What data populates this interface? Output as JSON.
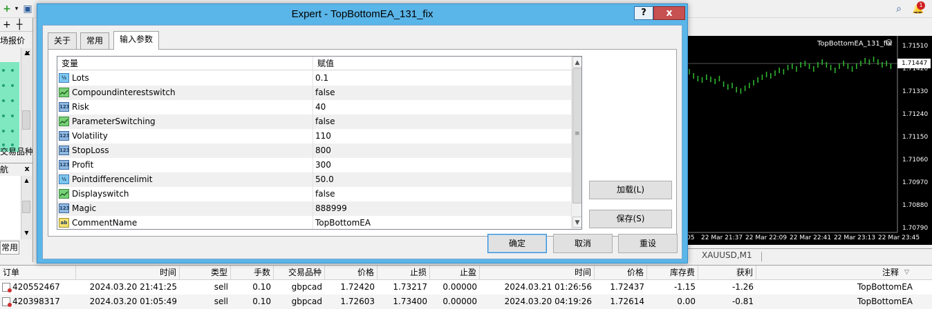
{
  "dialog": {
    "title": "Expert - TopBottomEA_131_fix",
    "help_label": "?",
    "close_label": "x",
    "tabs": [
      {
        "label": "关于"
      },
      {
        "label": "常用"
      },
      {
        "label": "输入参数",
        "active": true
      }
    ],
    "columns": {
      "variable": "变量",
      "value": "赋值"
    },
    "params": [
      {
        "name": "Lots",
        "value": "0.1",
        "icon": "double-value-icon",
        "badge": "½"
      },
      {
        "name": "Compoundinterestswitch",
        "value": "false",
        "icon": "bool-value-icon",
        "badge": ""
      },
      {
        "name": "Risk",
        "value": "40",
        "icon": "int-value-icon",
        "badge": "123"
      },
      {
        "name": "ParameterSwitching",
        "value": "false",
        "icon": "bool-value-icon",
        "badge": ""
      },
      {
        "name": "Volatility",
        "value": "110",
        "icon": "int-value-icon",
        "badge": "123"
      },
      {
        "name": "StopLoss",
        "value": "800",
        "icon": "int-value-icon",
        "badge": "123"
      },
      {
        "name": "Profit",
        "value": "300",
        "icon": "int-value-icon",
        "badge": "123"
      },
      {
        "name": "Pointdifferencelimit",
        "value": "50.0",
        "icon": "double-value-icon",
        "badge": "½"
      },
      {
        "name": "Displayswitch",
        "value": "false",
        "icon": "bool-value-icon",
        "badge": ""
      },
      {
        "name": "Magic",
        "value": "888999",
        "icon": "int-value-icon",
        "badge": "123"
      },
      {
        "name": "CommentName",
        "value": "TopBottomEA",
        "icon": "string-value-icon",
        "badge": "ab"
      }
    ],
    "buttons": {
      "load": "加载(L)",
      "save": "保存(S)",
      "ok": "确定",
      "cancel": "取消",
      "reset": "重设"
    }
  },
  "left_panel": {
    "market_watch_title": "场报价",
    "symbols_label": "交易品种",
    "navigator_title": "航",
    "common_tab": "常用",
    "close_label": "x"
  },
  "chart": {
    "title": "TopBottomEA_131_fix",
    "current_price": "1.71447",
    "price_ticks": [
      "1.71510",
      "1.71420",
      "1.71330",
      "1.71240",
      "1.71150",
      "1.71060",
      "1.70970",
      "1.70880",
      "1.70790"
    ],
    "time_ticks": [
      "05",
      "22 Mar 21:37",
      "22 Mar 22:09",
      "22 Mar 22:41",
      "22 Mar 23:13",
      "22 Mar 23:45"
    ],
    "tab_label": "XAUUSD,M1",
    "colors": {
      "candles": "#2fb52f",
      "background": "#000000"
    }
  },
  "terminal": {
    "headers": [
      "订单",
      "时间",
      "类型",
      "手数",
      "交易品种",
      "价格",
      "止损",
      "止盈",
      "时间",
      "价格",
      "库存费",
      "获利",
      "注释"
    ],
    "rows": [
      {
        "order": "420552467",
        "open_time": "2024.03.20 21:41:25",
        "type": "sell",
        "lots": "0.10",
        "symbol": "gbpcad",
        "price": "1.72420",
        "sl": "1.73217",
        "tp": "0.00000",
        "close_time": "2024.03.21 01:26:56",
        "cur_price": "1.72437",
        "swap": "-1.15",
        "profit": "-1.26",
        "comment": "TopBottomEA"
      },
      {
        "order": "420398317",
        "open_time": "2024.03.20 01:05:49",
        "type": "sell",
        "lots": "0.10",
        "symbol": "gbpcad",
        "price": "1.72603",
        "sl": "1.73400",
        "tp": "0.00000",
        "close_time": "2024.03.20 04:19:26",
        "cur_price": "1.72614",
        "swap": "0.00",
        "profit": "-0.81",
        "comment": "TopBottomEA"
      }
    ]
  },
  "toolbar": {
    "notification_count": "1"
  }
}
